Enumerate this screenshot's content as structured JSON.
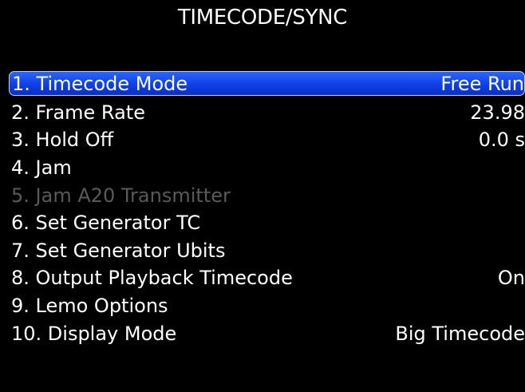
{
  "screen": {
    "title": "TIMECODE/SYNC"
  },
  "menu": {
    "items": [
      {
        "label": "1. Timecode Mode",
        "value": "Free Run",
        "selected": true,
        "enabled": true
      },
      {
        "label": "2. Frame Rate",
        "value": "23.98",
        "selected": false,
        "enabled": true
      },
      {
        "label": "3. Hold Off",
        "value": "0.0 s",
        "selected": false,
        "enabled": true
      },
      {
        "label": "4. Jam",
        "value": "",
        "selected": false,
        "enabled": true
      },
      {
        "label": "5. Jam A20 Transmitter",
        "value": "",
        "selected": false,
        "enabled": false
      },
      {
        "label": "6. Set Generator TC",
        "value": "",
        "selected": false,
        "enabled": true
      },
      {
        "label": "7. Set Generator Ubits",
        "value": "",
        "selected": false,
        "enabled": true
      },
      {
        "label": "8. Output Playback Timecode",
        "value": "On",
        "selected": false,
        "enabled": true
      },
      {
        "label": "9. Lemo Options",
        "value": "",
        "selected": false,
        "enabled": true
      },
      {
        "label": "10. Display Mode",
        "value": "Big Timecode",
        "selected": false,
        "enabled": true
      }
    ]
  },
  "colors": {
    "background": "#000000",
    "text": "#ffffff",
    "highlight": "#1a4cf0",
    "disabled_text": "#5a5a5a"
  }
}
